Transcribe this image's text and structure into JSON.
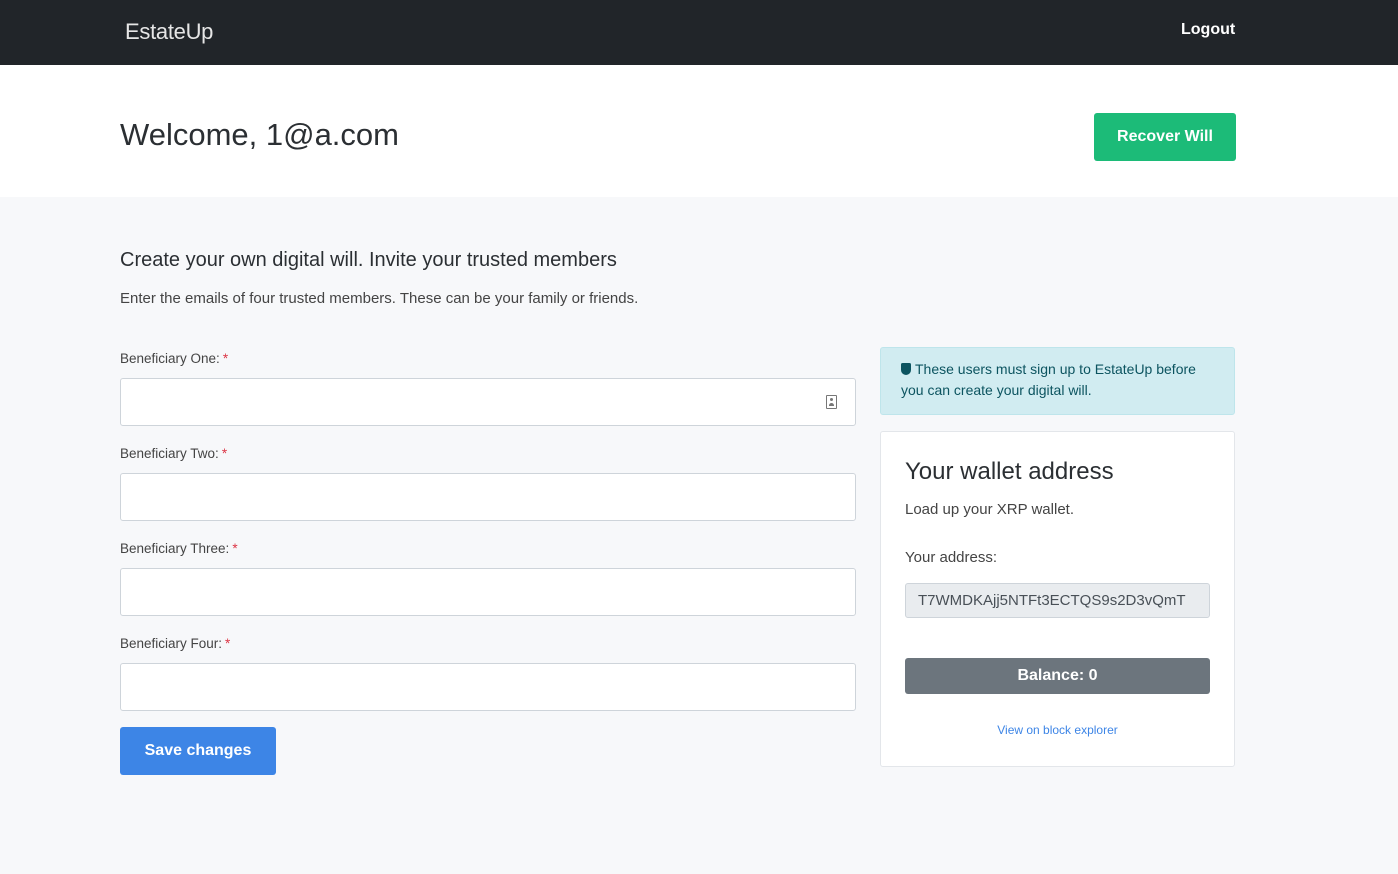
{
  "navbar": {
    "brand": "EstateUp",
    "logout_label": "Logout"
  },
  "hero": {
    "welcome": "Welcome, 1@a.com",
    "recover_label": "Recover Will"
  },
  "form": {
    "title": "Create your own digital will. Invite your trusted members",
    "subtitle": "Enter the emails of four trusted members. These can be your family or friends.",
    "required_mark": "*",
    "fields": [
      {
        "label": "Beneficiary One:",
        "value": ""
      },
      {
        "label": "Beneficiary Two:",
        "value": ""
      },
      {
        "label": "Beneficiary Three:",
        "value": ""
      },
      {
        "label": "Beneficiary Four:",
        "value": ""
      }
    ],
    "save_label": "Save changes"
  },
  "alert": {
    "text": "These users must sign up to EstateUp before you can create your digital will."
  },
  "wallet": {
    "title": "Your wallet address",
    "subtitle": "Load up your XRP wallet.",
    "address_label": "Your address:",
    "address_value": "T7WMDKAjj5NTFt3ECTQS9s2D3vQmT",
    "balance_label": "Balance: 0",
    "explorer_label": "View on block explorer"
  },
  "colors": {
    "navbar": "#212529",
    "recover": "#1cbb78",
    "save": "#3d85e6",
    "alert_bg": "#d1ecf1",
    "balance": "#6c757d"
  }
}
